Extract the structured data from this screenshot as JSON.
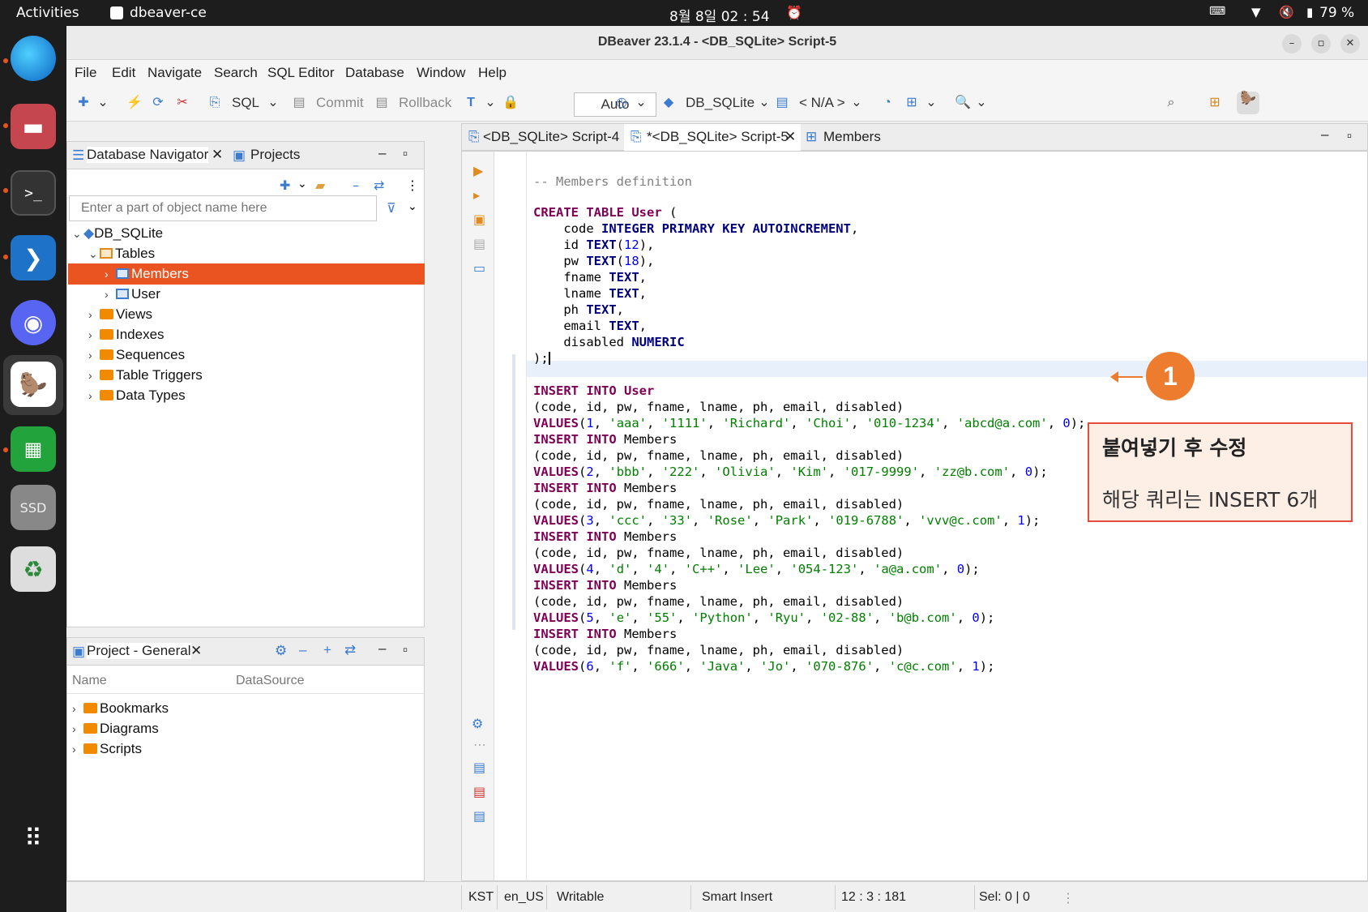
{
  "topbar": {
    "activities": "Activities",
    "app_name": "dbeaver-ce",
    "clock": "8월 8일  02 : 54",
    "battery": "79 %"
  },
  "window": {
    "title": "DBeaver 23.1.4 - <DB_SQLite> Script-5"
  },
  "menu": [
    "File",
    "Edit",
    "Navigate",
    "Search",
    "SQL Editor",
    "Database",
    "Window",
    "Help"
  ],
  "toolbar": {
    "sql": "SQL",
    "commit": "Commit",
    "rollback": "Rollback",
    "mode": "Auto",
    "connection": "DB_SQLite",
    "schema": "< N/A >"
  },
  "navigator": {
    "tab1": "Database Navigator",
    "tab2": "Projects",
    "filter_placeholder": "Enter a part of object name here",
    "tree": {
      "db": "DB_SQLite",
      "tables": "Tables",
      "members": "Members",
      "user": "User",
      "views": "Views",
      "indexes": "Indexes",
      "sequences": "Sequences",
      "triggers": "Table Triggers",
      "types": "Data Types"
    }
  },
  "project": {
    "tab": "Project - General",
    "col_name": "Name",
    "col_source": "DataSource",
    "items": [
      "Bookmarks",
      "Diagrams",
      "Scripts"
    ]
  },
  "editor_tabs": {
    "tab1": "<DB_SQLite> Script-4",
    "tab2": "*<DB_SQLite> Script-5",
    "tab3": "Members"
  },
  "code": {
    "comment": "-- Members definition",
    "create": [
      "CREATE TABLE",
      "User",
      "("
    ],
    "cols": [
      [
        "code",
        "INTEGER PRIMARY KEY AUTOINCREMENT",
        ","
      ],
      [
        "id",
        "TEXT",
        "(",
        "12",
        "),"
      ],
      [
        "pw",
        "TEXT",
        "(",
        "18",
        "),"
      ],
      [
        "fname",
        "TEXT",
        ","
      ],
      [
        "lname",
        "TEXT",
        ","
      ],
      [
        "ph",
        "TEXT",
        ","
      ],
      [
        "email",
        "TEXT",
        ","
      ],
      [
        "disabled",
        "NUMERIC",
        ""
      ]
    ],
    "close": ");",
    "inserts": [
      {
        "table": "User",
        "cols": "(code, id, pw, fname, lname, ph, email, disabled)",
        "n": "1",
        "id": "'aaa'",
        "pw": "'1111'",
        "fn": "'Richard'",
        "ln": "'Choi'",
        "ph": "'010-1234'",
        "em": "'abcd@a.com'",
        "d": "0"
      },
      {
        "table": "Members",
        "cols": "(code, id, pw, fname, lname, ph, email, disabled)",
        "n": "2",
        "id": "'bbb'",
        "pw": "'222'",
        "fn": "'Olivia'",
        "ln": "'Kim'",
        "ph": "'017-9999'",
        "em": "'zz@b.com'",
        "d": "0"
      },
      {
        "table": "Members",
        "cols": "(code, id, pw, fname, lname, ph, email, disabled)",
        "n": "3",
        "id": "'ccc'",
        "pw": "'33'",
        "fn": "'Rose'",
        "ln": "'Park'",
        "ph": "'019-6788'",
        "em": "'vvv@c.com'",
        "d": "1"
      },
      {
        "table": "Members",
        "cols": "(code, id, pw, fname, lname, ph, email, disabled)",
        "n": "4",
        "id": "'d'",
        "pw": "'4'",
        "fn": "'C++'",
        "ln": "'Lee'",
        "ph": "'054-123'",
        "em": "'a@a.com'",
        "d": "0"
      },
      {
        "table": "Members",
        "cols": "(code, id, pw, fname, lname, ph, email, disabled)",
        "n": "5",
        "id": "'e'",
        "pw": "'55'",
        "fn": "'Python'",
        "ln": "'Ryu'",
        "ph": "'02-88'",
        "em": "'b@b.com'",
        "d": "0"
      },
      {
        "table": "Members",
        "cols": "(code, id, pw, fname, lname, ph, email, disabled)",
        "n": "6",
        "id": "'f'",
        "pw": "'666'",
        "fn": "'Java'",
        "ln": "'Jo'",
        "ph": "'070-876'",
        "em": "'c@c.com'",
        "d": "1"
      }
    ],
    "insert_kw": "INSERT INTO",
    "values_kw": "VALUES"
  },
  "annotation": {
    "badge": "1",
    "title": "붙여넣기 후 수정",
    "desc": "해당 쿼리는 INSERT 6개"
  },
  "status": {
    "tz": "KST",
    "locale": "en_US",
    "mode": "Writable",
    "insert": "Smart Insert",
    "pos": "12 : 3 : 181",
    "sel": "Sel: 0 | 0"
  },
  "colors": {
    "selection": "#e95420",
    "keyword": "#7f0055",
    "string": "#007f00",
    "number": "#0000ff"
  }
}
